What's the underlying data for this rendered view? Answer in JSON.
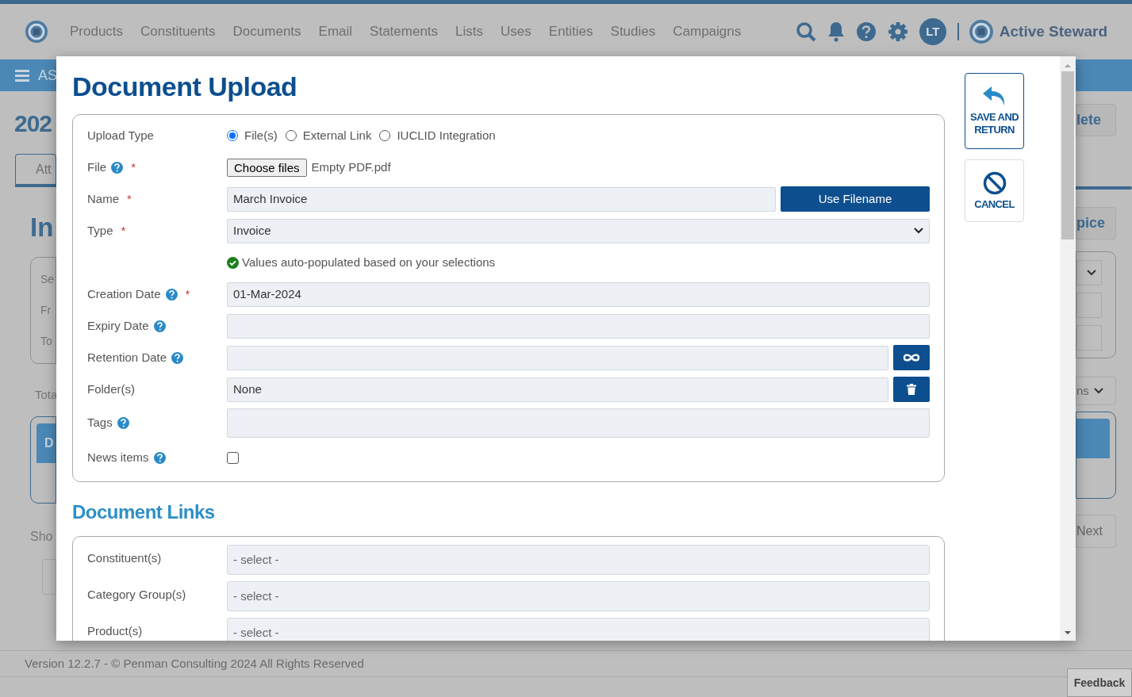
{
  "header": {
    "nav": [
      "Products",
      "Constituents",
      "Documents",
      "Email",
      "Statements",
      "Lists",
      "Uses",
      "Entities",
      "Studies",
      "Campaigns"
    ],
    "user_initials": "LT",
    "brand": "Active Steward"
  },
  "subbar": {
    "text": "AS"
  },
  "background": {
    "page_title": "202",
    "tab": "Att",
    "section_title": "In",
    "filter_labels": [
      "Se",
      "Fr",
      "To"
    ],
    "total": "Tota",
    "table_header": "D",
    "show": "Sho",
    "delete_button": "lete",
    "invoice_button": "pice",
    "columns_button": "ns",
    "next_button": "Next"
  },
  "modal": {
    "title": "Document Upload",
    "upload_type": {
      "label": "Upload Type",
      "options": [
        {
          "label": "File(s)",
          "selected": true
        },
        {
          "label": "External Link",
          "selected": false
        },
        {
          "label": "IUCLID Integration",
          "selected": false
        }
      ]
    },
    "fields": [
      {
        "kind": "file",
        "label": "File",
        "help": true,
        "required_mark": "*",
        "button": "Choose files",
        "value": "Empty PDF.pdf"
      },
      {
        "kind": "text_button",
        "label": "Name",
        "help": false,
        "required_mark": "*",
        "value": "March Invoice",
        "button": "Use Filename"
      },
      {
        "kind": "select",
        "label": "Type",
        "help": false,
        "required_mark": "*",
        "value": "Invoice"
      },
      {
        "kind": "note",
        "text": "Values auto-populated based on your selections"
      },
      {
        "kind": "text",
        "label": "Creation Date",
        "help": true,
        "required_mark": "*",
        "value": "01-Mar-2024"
      },
      {
        "kind": "text",
        "label": "Expiry Date",
        "help": true
      },
      {
        "kind": "infinity",
        "label": "Retention Date",
        "help": true
      },
      {
        "kind": "trash",
        "label": "Folder(s)",
        "help": false,
        "value": "None"
      },
      {
        "kind": "tags",
        "label": "Tags",
        "help": true
      },
      {
        "kind": "checkbox",
        "label": "News items",
        "help": true,
        "checked": false
      }
    ],
    "links_title": "Document Links",
    "links": [
      {
        "label": "Constituent(s)",
        "placeholder": "- select -"
      },
      {
        "label": "Category Group(s)",
        "placeholder": "- select -"
      },
      {
        "label": "Product(s)",
        "placeholder": "- select -"
      }
    ],
    "actions": [
      {
        "kind": "save",
        "label": "SAVE AND RETURN"
      },
      {
        "kind": "cancel",
        "label": "CANCEL"
      }
    ]
  },
  "footer": "Version 12.2.7 - © Penman Consulting 2024 All Rights Reserved",
  "feedback": "Feedback"
}
